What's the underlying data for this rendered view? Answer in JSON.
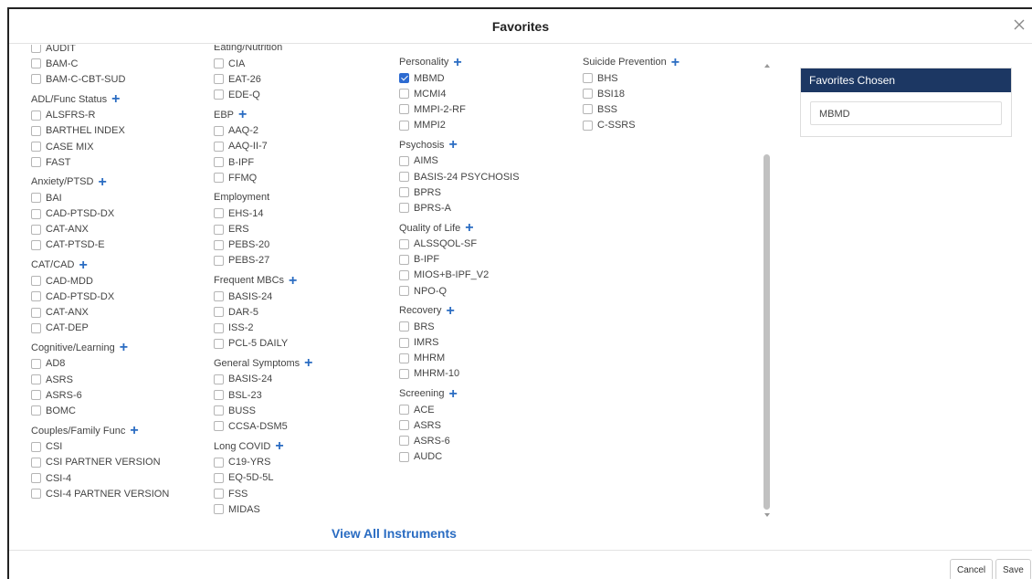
{
  "dialog": {
    "title": "Favorites"
  },
  "columns": [
    [
      {
        "title": "",
        "items": [
          {
            "label": "AUDIT",
            "checked": false
          },
          {
            "label": "BAM-C",
            "checked": false
          },
          {
            "label": "BAM-C-CBT-SUD",
            "checked": false
          }
        ]
      },
      {
        "title": "ADL/Func Status",
        "items": [
          {
            "label": "ALSFRS-R",
            "checked": false
          },
          {
            "label": "BARTHEL INDEX",
            "checked": false
          },
          {
            "label": "CASE MIX",
            "checked": false
          },
          {
            "label": "FAST",
            "checked": false
          }
        ]
      },
      {
        "title": "Anxiety/PTSD",
        "items": [
          {
            "label": "BAI",
            "checked": false
          },
          {
            "label": "CAD-PTSD-DX",
            "checked": false
          },
          {
            "label": "CAT-ANX",
            "checked": false
          },
          {
            "label": "CAT-PTSD-E",
            "checked": false
          }
        ]
      },
      {
        "title": "CAT/CAD",
        "items": [
          {
            "label": "CAD-MDD",
            "checked": false
          },
          {
            "label": "CAD-PTSD-DX",
            "checked": false
          },
          {
            "label": "CAT-ANX",
            "checked": false
          },
          {
            "label": "CAT-DEP",
            "checked": false
          }
        ]
      },
      {
        "title": "Cognitive/Learning",
        "items": [
          {
            "label": "AD8",
            "checked": false
          },
          {
            "label": "ASRS",
            "checked": false
          },
          {
            "label": "ASRS-6",
            "checked": false
          },
          {
            "label": "BOMC",
            "checked": false
          }
        ]
      },
      {
        "title": "Couples/Family Func",
        "items": [
          {
            "label": "CSI",
            "checked": false
          },
          {
            "label": "CSI PARTNER VERSION",
            "checked": false
          },
          {
            "label": "CSI-4",
            "checked": false
          },
          {
            "label": "CSI-4 PARTNER VERSION",
            "checked": false
          }
        ]
      }
    ],
    [
      {
        "title": "Eating/Nutrition",
        "noPlus": true,
        "items": [
          {
            "label": "CIA",
            "checked": false
          },
          {
            "label": "EAT-26",
            "checked": false
          },
          {
            "label": "EDE-Q",
            "checked": false
          }
        ]
      },
      {
        "title": "EBP",
        "items": [
          {
            "label": "AAQ-2",
            "checked": false
          },
          {
            "label": "AAQ-II-7",
            "checked": false
          },
          {
            "label": "B-IPF",
            "checked": false
          },
          {
            "label": "FFMQ",
            "checked": false
          }
        ]
      },
      {
        "title": "Employment",
        "noPlus": true,
        "items": [
          {
            "label": "EHS-14",
            "checked": false
          },
          {
            "label": "ERS",
            "checked": false
          },
          {
            "label": "PEBS-20",
            "checked": false
          },
          {
            "label": "PEBS-27",
            "checked": false
          }
        ]
      },
      {
        "title": "Frequent MBCs",
        "items": [
          {
            "label": "BASIS-24",
            "checked": false
          },
          {
            "label": "DAR-5",
            "checked": false
          },
          {
            "label": "ISS-2",
            "checked": false
          },
          {
            "label": "PCL-5 DAILY",
            "checked": false
          }
        ]
      },
      {
        "title": "General Symptoms",
        "items": [
          {
            "label": "BASIS-24",
            "checked": false
          },
          {
            "label": "BSL-23",
            "checked": false
          },
          {
            "label": "BUSS",
            "checked": false
          },
          {
            "label": "CCSA-DSM5",
            "checked": false
          }
        ]
      },
      {
        "title": "Long COVID",
        "items": [
          {
            "label": "C19-YRS",
            "checked": false
          },
          {
            "label": "EQ-5D-5L",
            "checked": false
          },
          {
            "label": "FSS",
            "checked": false
          },
          {
            "label": "MIDAS",
            "checked": false
          }
        ]
      }
    ],
    [
      {
        "title": "Personality",
        "items": [
          {
            "label": "MBMD",
            "checked": true
          },
          {
            "label": "MCMI4",
            "checked": false
          },
          {
            "label": "MMPI-2-RF",
            "checked": false
          },
          {
            "label": "MMPI2",
            "checked": false
          }
        ]
      },
      {
        "title": "Psychosis",
        "items": [
          {
            "label": "AIMS",
            "checked": false
          },
          {
            "label": "BASIS-24 PSYCHOSIS",
            "checked": false
          },
          {
            "label": "BPRS",
            "checked": false
          },
          {
            "label": "BPRS-A",
            "checked": false
          }
        ]
      },
      {
        "title": "Quality of Life",
        "items": [
          {
            "label": "ALSSQOL-SF",
            "checked": false
          },
          {
            "label": "B-IPF",
            "checked": false
          },
          {
            "label": "MIOS+B-IPF_V2",
            "checked": false
          },
          {
            "label": "NPO-Q",
            "checked": false
          }
        ]
      },
      {
        "title": "Recovery",
        "items": [
          {
            "label": "BRS",
            "checked": false
          },
          {
            "label": "IMRS",
            "checked": false
          },
          {
            "label": "MHRM",
            "checked": false
          },
          {
            "label": "MHRM-10",
            "checked": false
          }
        ]
      },
      {
        "title": "Screening",
        "items": [
          {
            "label": "ACE",
            "checked": false
          },
          {
            "label": "ASRS",
            "checked": false
          },
          {
            "label": "ASRS-6",
            "checked": false
          },
          {
            "label": "AUDC",
            "checked": false
          }
        ]
      }
    ],
    [
      {
        "title": "Suicide Prevention",
        "items": [
          {
            "label": "BHS",
            "checked": false
          },
          {
            "label": "BSI18",
            "checked": false
          },
          {
            "label": "BSS",
            "checked": false
          },
          {
            "label": "C-SSRS",
            "checked": false
          }
        ]
      }
    ]
  ],
  "view_all_label": "View All Instruments",
  "favorites_panel": {
    "title": "Favorites Chosen",
    "chosen": [
      "MBMD"
    ]
  },
  "footer": {
    "cancel_label": "Cancel",
    "save_label": "Save"
  },
  "colors": {
    "accent": "#2a6cc2",
    "panel_header": "#1c3763"
  }
}
